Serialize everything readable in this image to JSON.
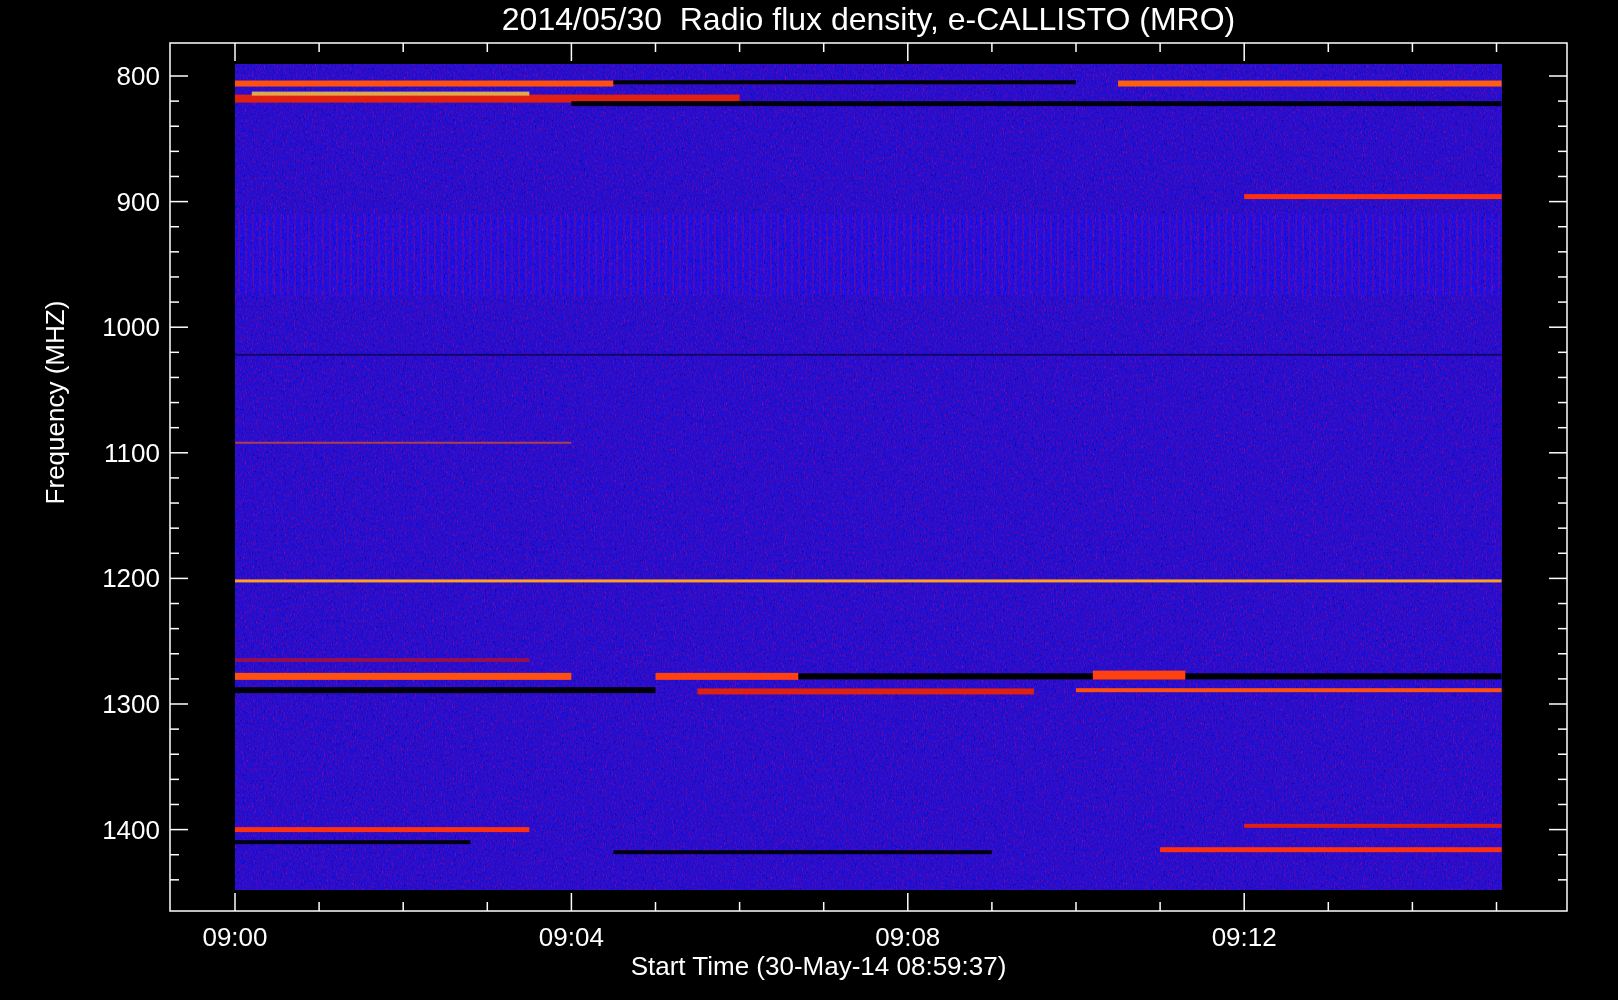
{
  "title": "2014/05/30  Radio flux density, e-CALLISTO (MRO)",
  "ylabel": "Frequency (MHZ)",
  "xlabel": "Start Time (30-May-14 08:59:37)",
  "yticks": [
    "800",
    "900",
    "1000",
    "1100",
    "1200",
    "1300",
    "1400"
  ],
  "xticks": [
    "09:00",
    "09:04",
    "09:08",
    "09:12"
  ]
}
